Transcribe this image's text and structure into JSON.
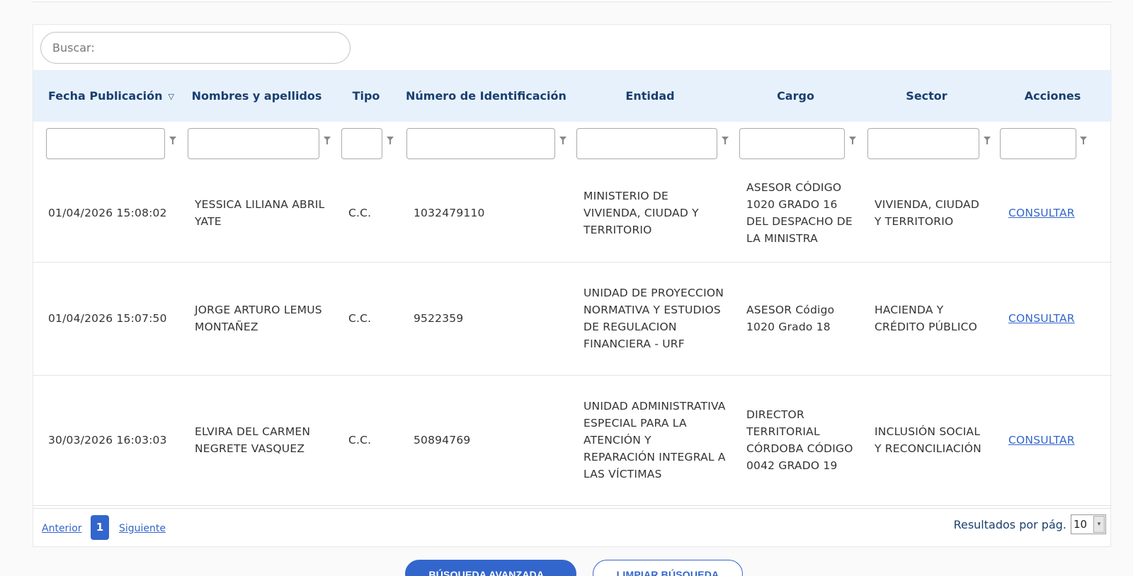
{
  "search": {
    "placeholder": "Buscar:"
  },
  "table": {
    "headers": {
      "fecha": "Fecha Publicación",
      "nombres": "Nombres y apellidos",
      "tipo": "Tipo",
      "numero": "Número de Identificación",
      "entidad": "Entidad",
      "cargo": "Cargo",
      "sector": "Sector",
      "acciones": "Acciones"
    },
    "rows": [
      {
        "fecha": "01/04/2026 15:08:02",
        "nombres": "YESSICA LILIANA ABRIL YATE",
        "tipo": "C.C.",
        "numero": "1032479110",
        "entidad": "MINISTERIO DE VIVIENDA, CIUDAD Y TERRITORIO",
        "cargo": "ASESOR CÓDIGO 1020 GRADO 16 DEL DESPACHO DE LA MINISTRA",
        "sector": "VIVIENDA, CIUDAD Y TERRITORIO",
        "accion": "CONSULTAR"
      },
      {
        "fecha": "01/04/2026 15:07:50",
        "nombres": "JORGE ARTURO LEMUS MONTAÑEZ",
        "tipo": "C.C.",
        "numero": "9522359",
        "entidad": "UNIDAD DE PROYECCION NORMATIVA Y ESTUDIOS DE REGULACION FINANCIERA - URF",
        "cargo": "ASESOR Código 1020 Grado 18",
        "sector": "HACIENDA Y CRÉDITO PÚBLICO",
        "accion": "CONSULTAR"
      },
      {
        "fecha": "30/03/2026 16:03:03",
        "nombres": "ELVIRA DEL CARMEN NEGRETE VASQUEZ",
        "tipo": "C.C.",
        "numero": "50894769",
        "entidad": "UNIDAD ADMINISTRATIVA ESPECIAL PARA LA ATENCIÓN Y REPARACIÓN INTEGRAL A LAS VÍCTIMAS",
        "cargo": "DIRECTOR TERRITORIAL CÓRDOBA CÓDIGO 0042 GRADO 19",
        "sector": "INCLUSIÓN SOCIAL Y RECONCILIACIÓN",
        "accion": "CONSULTAR"
      }
    ]
  },
  "pagination": {
    "prev": "Anterior",
    "current": "1",
    "next": "Siguiente",
    "results_label": "Resultados por pág.",
    "per_page": "10"
  },
  "buttons": {
    "advanced": "BÚSQUEDA AVANZADA...",
    "clear": "LIMPIAR BÚSQUEDA"
  },
  "colors": {
    "accent": "#3366cc",
    "header_bg": "#e7f1fc",
    "header_text": "#1a3f6f"
  }
}
